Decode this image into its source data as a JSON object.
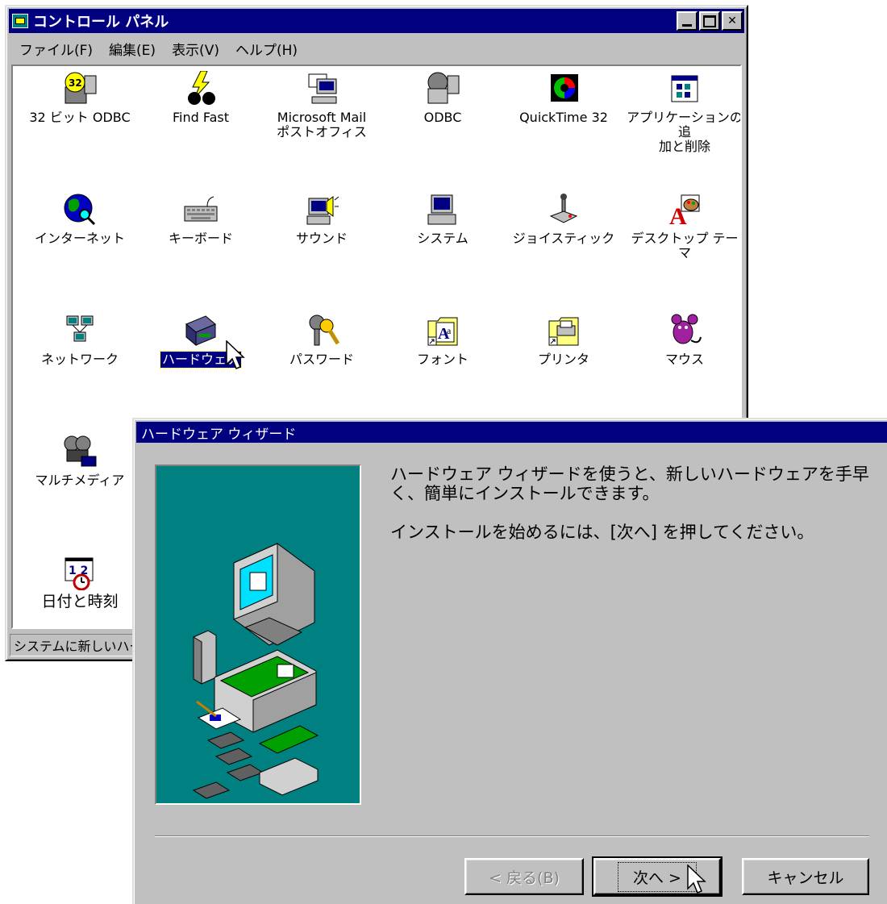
{
  "control_panel": {
    "title": "コントロール パネル",
    "menu": [
      "ファイル(F)",
      "編集(E)",
      "表示(V)",
      "ヘルプ(H)"
    ],
    "icons": [
      {
        "label": "32 ビット ODBC",
        "icon": "odbc32-icon"
      },
      {
        "label": "Find Fast",
        "icon": "find-fast-icon"
      },
      {
        "label": "Microsoft Mail\nポストオフィス",
        "icon": "mail-postoffice-icon"
      },
      {
        "label": "ODBC",
        "icon": "odbc-icon"
      },
      {
        "label": "QuickTime 32",
        "icon": "quicktime-icon"
      },
      {
        "label": "アプリケーションの追\n加と削除",
        "icon": "add-remove-programs-icon"
      },
      {
        "label": "インターネット",
        "icon": "internet-icon"
      },
      {
        "label": "キーボード",
        "icon": "keyboard-icon"
      },
      {
        "label": "サウンド",
        "icon": "sound-icon"
      },
      {
        "label": "システム",
        "icon": "system-icon"
      },
      {
        "label": "ジョイスティック",
        "icon": "joystick-icon"
      },
      {
        "label": "デスクトップ テーマ",
        "icon": "desktop-themes-icon"
      },
      {
        "label": "ネットワーク",
        "icon": "network-icon"
      },
      {
        "label": "ハードウェア",
        "icon": "hardware-icon",
        "selected": true
      },
      {
        "label": "パスワード",
        "icon": "passwords-icon"
      },
      {
        "label": "フォント",
        "icon": "fonts-icon"
      },
      {
        "label": "プリンタ",
        "icon": "printers-icon"
      },
      {
        "label": "マウス",
        "icon": "mouse-icon"
      },
      {
        "label": "マルチメディア",
        "icon": "multimedia-icon"
      },
      {
        "label": "日付と時刻",
        "icon": "date-time-icon"
      }
    ],
    "status": "システムに新しいハード"
  },
  "wizard": {
    "title": "ハードウェア ウィザード",
    "paragraph1": "ハードウェア ウィザードを使うと、新しいハードウェアを手早く、簡単にインストールできます。",
    "paragraph2": "インストールを始めるには、[次へ] を押してください。",
    "back_label": "< 戻る(B)",
    "next_label": "次へ >",
    "cancel_label": "キャンセル"
  },
  "colors": {
    "titlebar": "#000080",
    "face": "#c0c0c0",
    "illustration_bg": "#008080"
  }
}
